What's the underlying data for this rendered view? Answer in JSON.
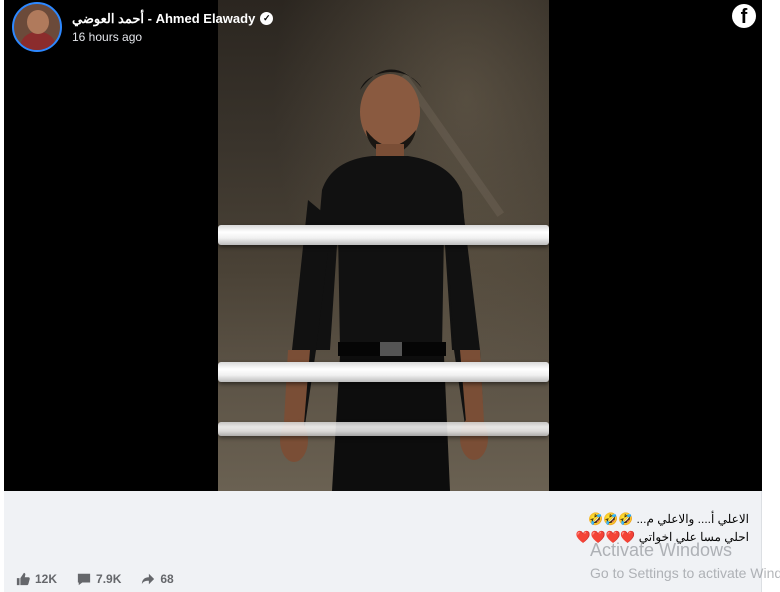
{
  "post": {
    "author_name": "أحمد العوضي - Ahmed Elawady",
    "timestamp": "16 hours ago",
    "verified_icon": "verified-badge-icon",
    "platform_icon": "facebook-logo-icon",
    "caption_line1": "الاعلي أ.... والاعلي م... 🤣🤣🤣",
    "caption_line2": "احلي مسا علي اخواتي ❤️❤️❤️❤️",
    "verified_mark": "✓",
    "platform_mark": "f"
  },
  "stats": {
    "reactions": "12K",
    "comments": "7.9K",
    "shares": "68"
  },
  "watermark": {
    "title": "Activate Windows",
    "subtitle": "Go to Settings to activate Windows."
  }
}
